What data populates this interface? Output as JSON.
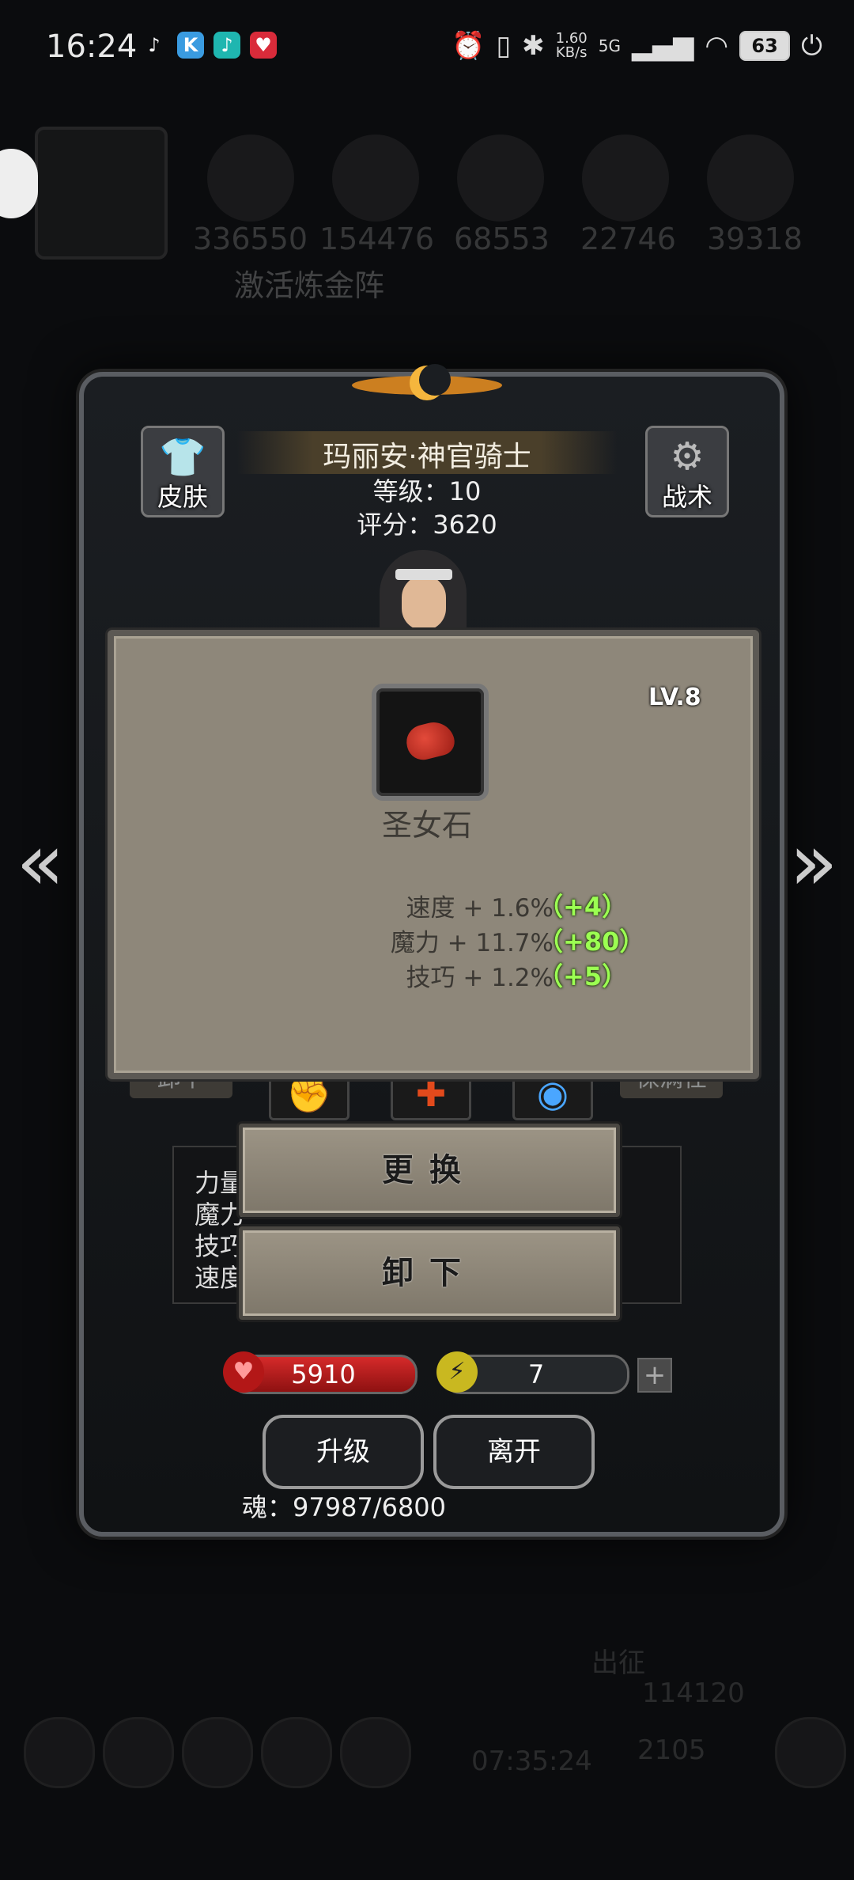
{
  "status_bar": {
    "time": "16:24",
    "network_speed": "1.60",
    "network_unit": "KB/s",
    "network_type": "5G",
    "battery": "63"
  },
  "background": {
    "resource_counts": [
      "336550",
      "154476",
      "68553",
      "22746",
      "39318"
    ],
    "activate_label": "激活炼金阵",
    "expedition_label": "出征",
    "gold": "114120",
    "gems": "2105",
    "timer": "07:35:24"
  },
  "character": {
    "name": "玛丽安·神官骑士",
    "level": "等级：10",
    "score": "评分：3620",
    "skin_label": "皮肤",
    "tactics_label": "战术",
    "unequip_tab": "卸下",
    "keep_tab": "保满仕"
  },
  "stats_panel": {
    "labels": [
      "力量",
      "魔力",
      "技巧",
      "速度"
    ]
  },
  "item_popup": {
    "level": "LV.8",
    "name": "圣女石",
    "stats": [
      {
        "text": "速度 + 1.6%",
        "bonus": "（+4）"
      },
      {
        "text": "魔力 + 11.7%",
        "bonus": "（+80）"
      },
      {
        "text": "技巧 + 1.2%",
        "bonus": "（+5）"
      }
    ]
  },
  "actions": {
    "replace": "更换",
    "remove": "卸下"
  },
  "resources": {
    "hp": "5910",
    "energy": "7"
  },
  "buttons": {
    "upgrade": "升级",
    "leave": "离开"
  },
  "soul": "魂：97987/6800"
}
